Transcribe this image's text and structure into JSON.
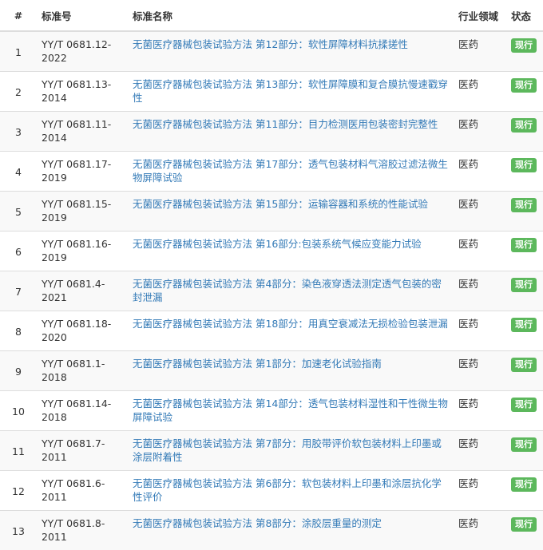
{
  "table": {
    "headers": {
      "num": "#",
      "code": "标准号",
      "name": "标准名称",
      "industry": "行业领域",
      "status": "状态"
    },
    "rows": [
      {
        "num": "1",
        "code": "YY/T 0681.12-2022",
        "name": "无菌医疗器械包装试验方法 第12部分：软性屏障材料抗揉搓性",
        "industry": "医药",
        "status": "现行"
      },
      {
        "num": "2",
        "code": "YY/T 0681.13-2014",
        "name": "无菌医疗器械包装试验方法 第13部分：软性屏障膜和复合膜抗慢速戳穿性",
        "industry": "医药",
        "status": "现行"
      },
      {
        "num": "3",
        "code": "YY/T 0681.11-2014",
        "name": "无菌医疗器械包装试验方法 第11部分：目力检测医用包装密封完整性",
        "industry": "医药",
        "status": "现行"
      },
      {
        "num": "4",
        "code": "YY/T 0681.17-2019",
        "name": "无菌医疗器械包装试验方法 第17部分：透气包装材料气溶胶过滤法微生物屏障试验",
        "industry": "医药",
        "status": "现行"
      },
      {
        "num": "5",
        "code": "YY/T 0681.15-2019",
        "name": "无菌医疗器械包装试验方法 第15部分：运输容器和系统的性能试验",
        "industry": "医药",
        "status": "现行"
      },
      {
        "num": "6",
        "code": "YY/T 0681.16-2019",
        "name": "无菌医疗器械包装试验方法 第16部分:包装系统气候应变能力试验",
        "industry": "医药",
        "status": "现行"
      },
      {
        "num": "7",
        "code": "YY/T 0681.4-2021",
        "name": "无菌医疗器械包装试验方法 第4部分：染色液穿透法测定透气包装的密封泄漏",
        "industry": "医药",
        "status": "现行"
      },
      {
        "num": "8",
        "code": "YY/T 0681.18-2020",
        "name": "无菌医疗器械包装试验方法 第18部分：用真空衰减法无损检验包装泄漏",
        "industry": "医药",
        "status": "现行"
      },
      {
        "num": "9",
        "code": "YY/T 0681.1-2018",
        "name": "无菌医疗器械包装试验方法 第1部分：加速老化试验指南",
        "industry": "医药",
        "status": "现行"
      },
      {
        "num": "10",
        "code": "YY/T 0681.14-2018",
        "name": "无菌医疗器械包装试验方法 第14部分：透气包装材料湿性和干性微生物屏障试验",
        "industry": "医药",
        "status": "现行"
      },
      {
        "num": "11",
        "code": "YY/T 0681.7-2011",
        "name": "无菌医疗器械包装试验方法 第7部分：用胶带评价软包装材料上印墨或涂层附着性",
        "industry": "医药",
        "status": "现行"
      },
      {
        "num": "12",
        "code": "YY/T 0681.6-2011",
        "name": "无菌医疗器械包装试验方法 第6部分：软包装材料上印墨和涂层抗化学性评价",
        "industry": "医药",
        "status": "现行"
      },
      {
        "num": "13",
        "code": "YY/T 0681.8-2011",
        "name": "无菌医疗器械包装试验方法 第8部分：涂胶层重量的测定",
        "industry": "医药",
        "status": "现行"
      }
    ]
  },
  "colors": {
    "link": "#337ab7",
    "badge": "#5cb85c",
    "stripe": "#f9f9f9",
    "border": "#dddddd"
  }
}
